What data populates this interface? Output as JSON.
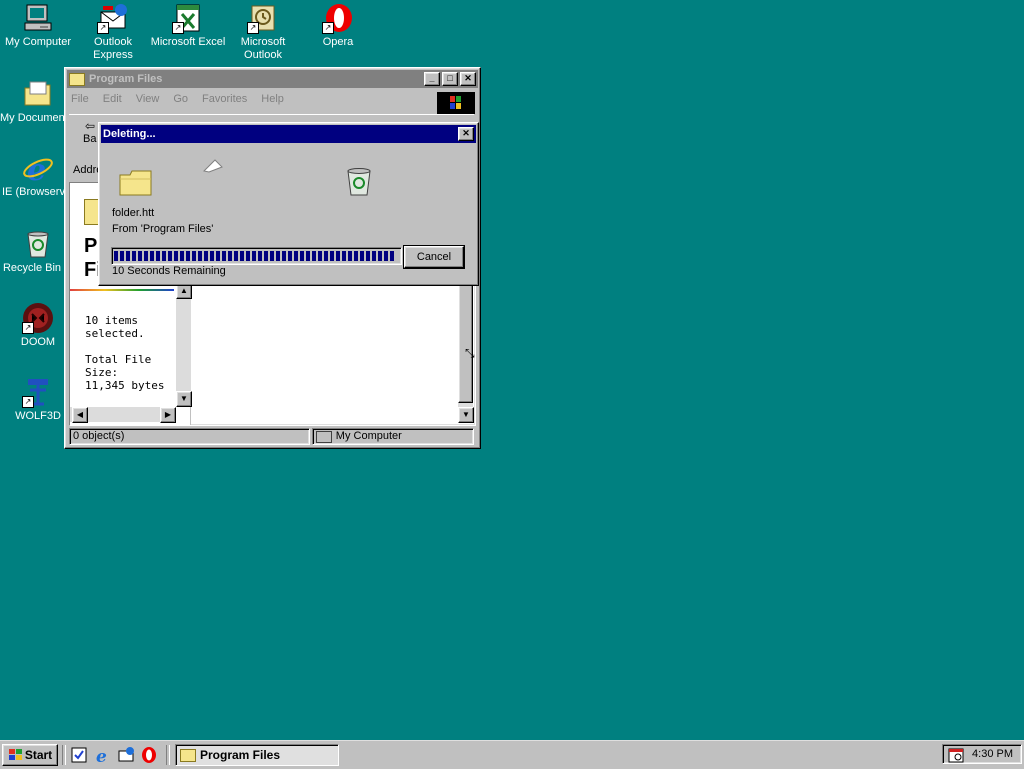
{
  "desktop": {
    "icons": [
      {
        "label": "My Computer"
      },
      {
        "label": "Outlook Express"
      },
      {
        "label": "Microsoft Excel"
      },
      {
        "label": "Microsoft Outlook"
      },
      {
        "label": "Opera"
      },
      {
        "label": "My Documents"
      },
      {
        "label": "IE (Browservice)"
      },
      {
        "label": "Recycle Bin"
      },
      {
        "label": "DOOM"
      },
      {
        "label": "WOLF3D"
      }
    ]
  },
  "explorer": {
    "title": "Program Files",
    "menu": [
      "File",
      "Edit",
      "View",
      "Go",
      "Favorites",
      "Help"
    ],
    "toolbar_back": "Back",
    "address_label": "Address",
    "left_pane": {
      "heading_line1": "Program",
      "heading_line2": "Files",
      "selected_text": "10 items selected.",
      "size_label": "Total File Size:",
      "size_value": "11,345 bytes"
    },
    "status": {
      "objects": "0 object(s)",
      "location": "My Computer"
    }
  },
  "dialog": {
    "title": "Deleting...",
    "filename": "folder.htt",
    "from": "From 'Program Files'",
    "remaining": "10 Seconds Remaining",
    "cancel_label": "Cancel",
    "progress_fraction": 0.99
  },
  "taskbar": {
    "start_label": "Start",
    "task_label": "Program Files",
    "clock": "4:30 PM"
  },
  "colors": {
    "desktop": "#008080",
    "active_title": "#000080",
    "inactive_title": "#808080"
  }
}
